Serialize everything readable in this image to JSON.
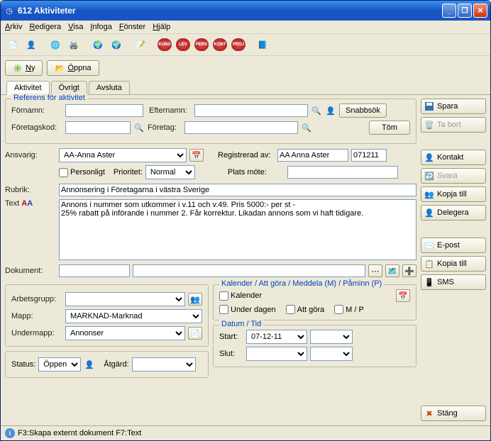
{
  "window": {
    "title": "612 Aktiviteter"
  },
  "menus": {
    "arkiv": "Arkiv",
    "redigera": "Redigera",
    "visa": "Visa",
    "infoga": "Infoga",
    "fonster": "Fönster",
    "hjalp": "Hjälp"
  },
  "toolbar_badges": [
    "KUND",
    "LEV",
    "PERS",
    "KONT",
    "PROJ"
  ],
  "actions": {
    "ny": "Ny",
    "oppna": "Öppna"
  },
  "tabs": {
    "aktivitet": "Aktivitet",
    "ovrigt": "Övrigt",
    "avsluta": "Avsluta"
  },
  "referens": {
    "legend": "Referens för aktivitet",
    "fornamn": "Förnamn:",
    "efternamn": "Efternamn:",
    "foretagskod": "Företagskod:",
    "foretag": "Företag:",
    "snabbsok": "Snabbsök",
    "tom": "Töm",
    "fornamn_val": "",
    "efternamn_val": "",
    "foretagskod_val": "",
    "foretag_val": ""
  },
  "mid": {
    "ansvarig": "Ansvarig:",
    "ansvarig_val": "AA-Anna Aster",
    "personligt": "Personligt",
    "prioritet": "Prioritet:",
    "prioritet_val": "Normal",
    "registrerad": "Registrerad av:",
    "registrerad_val": "AA Anna Aster",
    "registrerad_date": "071211",
    "plats": "Plats möte:",
    "plats_val": "",
    "rubrik": "Rubrik:",
    "rubrik_val": "Annonsering i Företagarna i västra Sverige",
    "text_lbl": "Text",
    "text_val": "Annons i nummer som utkommer i v.11 och v.49. Pris 5000:- per st -\n25% rabatt på införande i nummer 2. Får korrektur. Likadan annons som vi haft tidigare.",
    "dokument": "Dokument:",
    "dokument_val": ""
  },
  "grp": {
    "arbetsgrupp": "Arbetsgrupp:",
    "arbetsgrupp_val": "",
    "mapp": "Mapp:",
    "mapp_val": "MARKNAD-Marknad",
    "undermapp": "Undermapp:",
    "undermapp_val": "Annonser"
  },
  "kal": {
    "legend": "Kalender / Att göra /  Meddela (M) / Påminn (P)",
    "kalender": "Kalender",
    "underdagen": "Under dagen",
    "attgora": "Att göra",
    "mp": "M / P"
  },
  "datum": {
    "legend": "Datum / Tid",
    "start": "Start:",
    "start_val": "07-12-11",
    "slut": "Slut:",
    "slut_val": ""
  },
  "status_row": {
    "status": "Status:",
    "status_val": "Öppen",
    "atgard": "Åtgärd:",
    "atgard_val": ""
  },
  "side": {
    "spara": "Spara",
    "tabort": "Ta bort",
    "kontakt": "Kontakt",
    "svara": "Svara",
    "kopjatill1": "Kopja till",
    "delegera": "Delegera",
    "epost": "E-post",
    "kopiatill2": "Kopia till",
    "sms": "SMS",
    "stang": "Stäng"
  },
  "statusbar": "F3:Skapa externt dokument  F7:Text"
}
